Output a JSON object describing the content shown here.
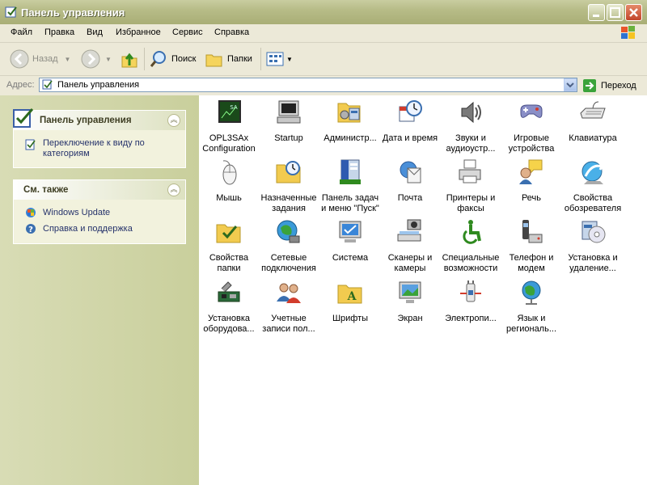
{
  "window": {
    "title": "Панель управления"
  },
  "menu": [
    "Файл",
    "Правка",
    "Вид",
    "Избранное",
    "Сервис",
    "Справка"
  ],
  "toolbar": {
    "back": "Назад",
    "search": "Поиск",
    "folders": "Папки"
  },
  "address": {
    "label": "Адрес:",
    "value": "Панель управления",
    "go": "Переход"
  },
  "left": {
    "panel1": {
      "title": "Панель управления",
      "link": "Переключение к виду по категориям"
    },
    "panel2": {
      "title": "См. также",
      "links": [
        "Windows Update",
        "Справка и поддержка"
      ]
    }
  },
  "items": [
    {
      "label": "OPL3SAx Configuration",
      "icon": "chip-icon"
    },
    {
      "label": "Startup",
      "icon": "computer-icon"
    },
    {
      "label": "Администр...",
      "icon": "admin-tools-icon"
    },
    {
      "label": "Дата и время",
      "icon": "clock-calendar-icon"
    },
    {
      "label": "Звуки и аудиоустр...",
      "icon": "speaker-icon"
    },
    {
      "label": "Игровые устройства",
      "icon": "gamepad-icon"
    },
    {
      "label": "Клавиатура",
      "icon": "keyboard-icon"
    },
    {
      "label": "Мышь",
      "icon": "mouse-icon"
    },
    {
      "label": "Назначенные задания",
      "icon": "scheduled-tasks-icon"
    },
    {
      "label": "Панель задач и меню \"Пуск\"",
      "icon": "taskbar-icon"
    },
    {
      "label": "Почта",
      "icon": "mail-icon"
    },
    {
      "label": "Принтеры и факсы",
      "icon": "printer-icon"
    },
    {
      "label": "Речь",
      "icon": "speech-icon"
    },
    {
      "label": "Свойства обозревателя",
      "icon": "internet-options-icon"
    },
    {
      "label": "Свойства папки",
      "icon": "folder-options-icon"
    },
    {
      "label": "Сетевые подключения",
      "icon": "network-icon"
    },
    {
      "label": "Система",
      "icon": "system-icon"
    },
    {
      "label": "Сканеры и камеры",
      "icon": "scanner-camera-icon"
    },
    {
      "label": "Специальные возможности",
      "icon": "accessibility-icon"
    },
    {
      "label": "Телефон и модем",
      "icon": "phone-modem-icon"
    },
    {
      "label": "Установка и удаление...",
      "icon": "add-remove-programs-icon"
    },
    {
      "label": "Установка оборудова...",
      "icon": "add-hardware-icon"
    },
    {
      "label": "Учетные записи пол...",
      "icon": "user-accounts-icon"
    },
    {
      "label": "Шрифты",
      "icon": "fonts-folder-icon"
    },
    {
      "label": "Экран",
      "icon": "display-icon"
    },
    {
      "label": "Электропи...",
      "icon": "power-options-icon"
    },
    {
      "label": "Язык и региональ...",
      "icon": "globe-region-icon"
    }
  ]
}
